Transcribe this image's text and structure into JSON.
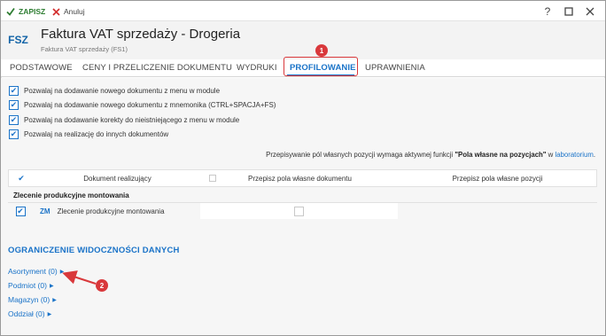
{
  "toolbar": {
    "save_label": "ZAPISZ",
    "cancel_label": "Anuluj",
    "help_label": "?",
    "maximize_label": "☐",
    "close_label": "✕"
  },
  "header": {
    "badge": "FSZ",
    "title": "Faktura VAT sprzedaży - Drogeria",
    "subtitle": "Faktura VAT sprzedaży (FS1)"
  },
  "tabs": [
    {
      "label": "PODSTAWOWE"
    },
    {
      "label": "CENY I PRZELICZENIE DOKUMENTU"
    },
    {
      "label": "WYDRUKI"
    },
    {
      "label": "PROFILOWANIE",
      "active": true
    },
    {
      "label": "UPRAWNIENIA"
    }
  ],
  "permissions": [
    {
      "label": "Pozwalaj na dodawanie nowego dokumentu z menu w module",
      "checked": true
    },
    {
      "label": "Pozwalaj na dodawanie nowego dokumentu z mnemonika (CTRL+SPACJA+FS)",
      "checked": true
    },
    {
      "label": "Pozwalaj na dodawanie korekty do nieistniejącego z menu w module",
      "checked": true
    },
    {
      "label": "Pozwalaj na realizację do innych dokumentów",
      "checked": true
    }
  ],
  "info": {
    "prefix": "Przepisywanie pól własnych pozycji wymaga aktywnej funkcji ",
    "feature": "\"Pola własne na pozycjach\"",
    "middle": " w ",
    "link": "laboratorium",
    "suffix": "."
  },
  "grid": {
    "headers": [
      "Dokument realizujący",
      "Przepisz pola własne dokumentu",
      "Przepisz pola własne pozycji"
    ],
    "group": "Zlecenie produkcyjne montowania",
    "rows": [
      {
        "code": "ZM",
        "name": "Zlecenie produkcyjne montowania",
        "checked": true,
        "copy_doc_fields": false
      }
    ]
  },
  "visibility": {
    "title": "OGRANICZENIE WIDOCZNOŚCI DANYCH",
    "links": [
      {
        "label": "Asortyment (0)"
      },
      {
        "label": "Podmiot (0)"
      },
      {
        "label": "Magazyn (0)"
      },
      {
        "label": "Oddział (0)"
      }
    ]
  },
  "callouts": [
    "1",
    "2"
  ],
  "colors": {
    "accent": "#1a73c8",
    "save_green": "#2e7d32",
    "cancel_red": "#d32f2f",
    "callout_red": "#d9383b"
  },
  "icons": {
    "save": "checkmark-icon",
    "cancel": "x-icon",
    "expand": "caret-right-icon"
  }
}
